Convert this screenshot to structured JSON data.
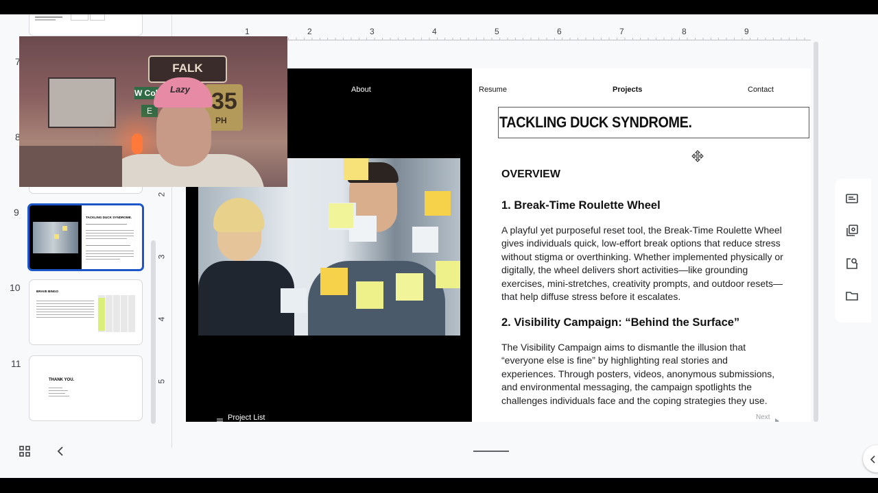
{
  "filmstrip": {
    "numbers": [
      "7",
      "8",
      "9",
      "10",
      "11"
    ],
    "thumb9_title": "TACKLING DUCK SYNDROME.",
    "thumb10_title": "BRAVE BINGO",
    "thumb11_title": "THANK YOU."
  },
  "ruler": {
    "h_numbers": [
      "1",
      "2",
      "3",
      "4",
      "5",
      "6",
      "7",
      "8",
      "9"
    ],
    "v_numbers": [
      "2",
      "3",
      "4",
      "5"
    ]
  },
  "webcam": {
    "sign_text": "FALK BRIDGE",
    "street_text": "W Col",
    "street_text2": "E",
    "speed_text": "35",
    "speed_unit": "PH",
    "hat_text": "Lazy"
  },
  "slide": {
    "nav": {
      "about": "About",
      "resume": "Resume",
      "projects": "Projects",
      "contact": "Contact"
    },
    "title": "TACKLING DUCK SYNDROME.",
    "overview": "OVERVIEW",
    "heading1": "1. Break-Time Roulette Wheel",
    "para1": "A playful yet purposeful reset tool, the Break-Time Roulette Wheel gives individuals quick, low-effort break options that reduce stress without stigma or overthinking. Whether implemented physically or digitally, the wheel delivers short activities—like grounding exercises, mini-stretches, creativity prompts, and outdoor resets—that help diffuse stress before it escalates.",
    "heading2": "2. Visibility Campaign: “Behind the Surface”",
    "para2": "The Visibility Campaign aims to dismantle the illusion that “everyone else is fine” by highlighting real stories and experiences. Through posters, videos, anonymous submissions, and environmental messaging, the campaign spotlights the challenges individuals face and the coping strategies they use.",
    "project_list": "Project List",
    "next": "Next"
  },
  "colors": {
    "accent": "#1a56c8",
    "sticky": "#f7e27a",
    "slide_dark": "#000000"
  },
  "icons": {
    "filmstrip_grid": "grid-icon",
    "collapse": "chevron-left-icon",
    "side_panel": [
      "notes-icon",
      "layers-icon",
      "image-search-icon",
      "folder-icon"
    ]
  }
}
